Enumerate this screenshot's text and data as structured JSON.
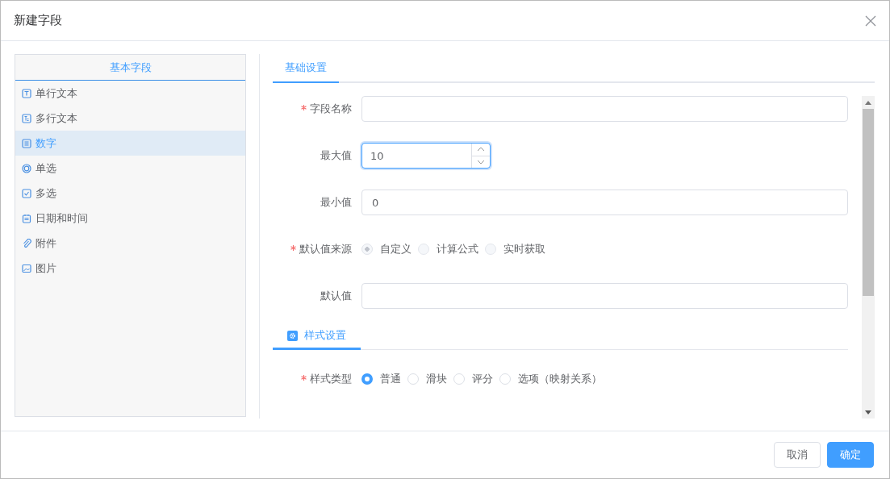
{
  "window": {
    "title": "新建字段"
  },
  "field_types": {
    "title": "基本字段",
    "items": [
      {
        "label": "单行文本",
        "kind": "text",
        "selected": false
      },
      {
        "label": "多行文本",
        "kind": "textarea",
        "selected": false
      },
      {
        "label": "数字",
        "kind": "number",
        "selected": true
      },
      {
        "label": "单选",
        "kind": "radio",
        "selected": false
      },
      {
        "label": "多选",
        "kind": "checkbox",
        "selected": false
      },
      {
        "label": "日期和时间",
        "kind": "date",
        "selected": false
      },
      {
        "label": "附件",
        "kind": "attachment",
        "selected": false
      },
      {
        "label": "图片",
        "kind": "image",
        "selected": false
      }
    ]
  },
  "tabs": [
    {
      "label": "基础设置",
      "selected": true
    }
  ],
  "basic_fields": [
    {
      "kind": "text",
      "label": "字段名称",
      "required": true
    },
    {
      "kind": "number",
      "label": "最大值",
      "required": false,
      "value": "10",
      "focused": true
    },
    {
      "kind": "text",
      "label": "最小值",
      "required": false,
      "value": "0"
    },
    {
      "kind": "radio",
      "label": "默认值来源",
      "required": true,
      "disabled": true,
      "options": [
        {
          "label": "自定义",
          "selected": true
        },
        {
          "label": "计算公式",
          "selected": false
        },
        {
          "label": "实时获取",
          "selected": false
        }
      ]
    },
    {
      "kind": "text",
      "label": "默认值",
      "required": false
    }
  ],
  "style_section": {
    "title": "样式设置",
    "fields": [
      {
        "kind": "radio",
        "label": "样式类型",
        "required": true,
        "disabled": false,
        "options": [
          {
            "label": "普通",
            "selected": true
          },
          {
            "label": "滑块",
            "selected": false
          },
          {
            "label": "评分",
            "selected": false
          },
          {
            "label": "选项（映射关系）",
            "selected": false
          }
        ]
      }
    ]
  },
  "buttons": [
    {
      "label": "取消",
      "kind": "secondary"
    },
    {
      "label": "确定",
      "kind": "primary"
    }
  ]
}
